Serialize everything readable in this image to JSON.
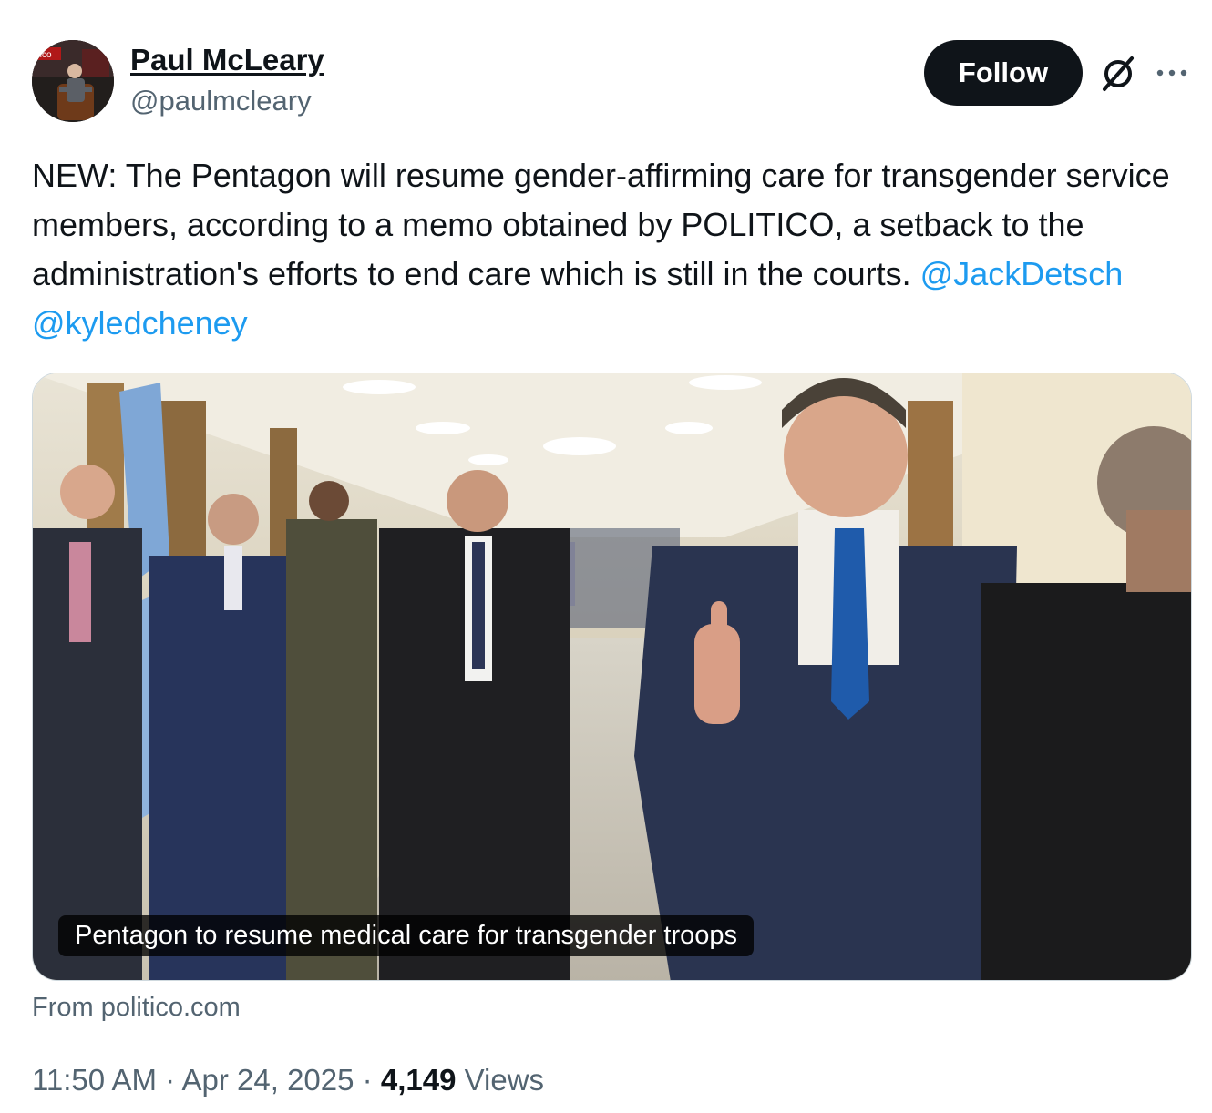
{
  "author": {
    "name": "Paul McLeary",
    "handle": "@paulmcleary",
    "avatar_logo_text": "tico"
  },
  "actions": {
    "follow_label": "Follow",
    "grok_icon": "grok-slash-circle-icon",
    "more_icon": "more-horizontal-icon"
  },
  "tweet": {
    "text": "NEW: The Pentagon will resume gender-affirming care for transgender service members, according to a memo obtained by POLITICO, a setback to the administration's efforts to end care which is still in the courts.",
    "mentions": [
      "@JackDetsch",
      "@kyledcheney"
    ]
  },
  "card": {
    "caption": "Pentagon to resume medical care for transgender troops",
    "source": "From politico.com"
  },
  "meta": {
    "time": "11:50 AM",
    "separator": "·",
    "date": "Apr 24, 2025",
    "views_count": "4,149",
    "views_label": "Views"
  },
  "colors": {
    "text": "#0f1419",
    "secondary": "#536471",
    "link": "#1d9bf0",
    "follow_bg": "#0f1419",
    "border": "#cfd9de"
  }
}
